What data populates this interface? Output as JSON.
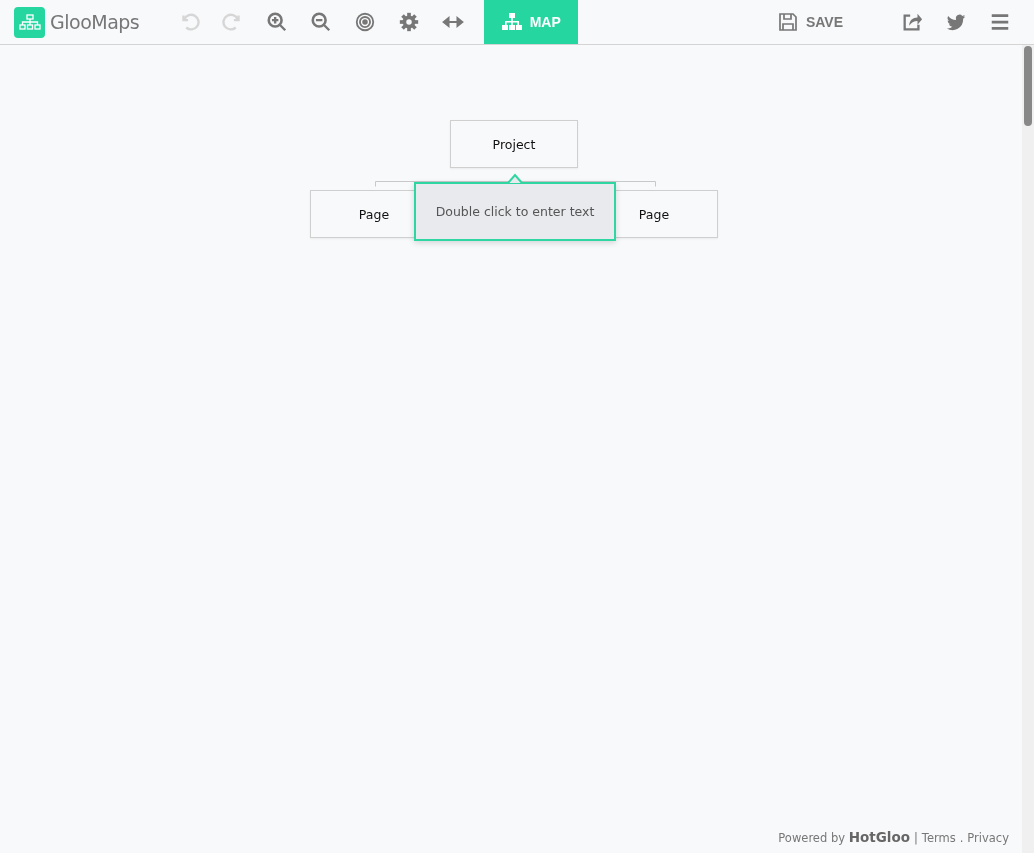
{
  "app": {
    "name": "GlooMaps"
  },
  "tools": [
    {
      "kind": "undo",
      "disabled": true
    },
    {
      "kind": "redo",
      "disabled": true
    },
    {
      "kind": "zoom-in",
      "disabled": false
    },
    {
      "kind": "zoom-out",
      "disabled": false
    },
    {
      "kind": "target",
      "disabled": false
    },
    {
      "kind": "settings",
      "disabled": false
    },
    {
      "kind": "width",
      "disabled": false
    }
  ],
  "view_tab": {
    "label": "MAP",
    "selected": true
  },
  "save_button": {
    "label": "SAVE"
  },
  "right_tools": [
    {
      "kind": "share"
    },
    {
      "kind": "twitter"
    },
    {
      "kind": "menu"
    }
  ],
  "map": {
    "root": {
      "text": "Project"
    },
    "children": [
      {
        "text": "Page"
      },
      {
        "text": "Page"
      }
    ],
    "tooltip": "Double click to enter text"
  },
  "footer": {
    "powered": "Powered by **HotGloo**",
    "separator": "|",
    "links": [
      {
        "text": "Terms"
      },
      {
        "text": "Privacy"
      }
    ],
    "link_separator": "."
  }
}
